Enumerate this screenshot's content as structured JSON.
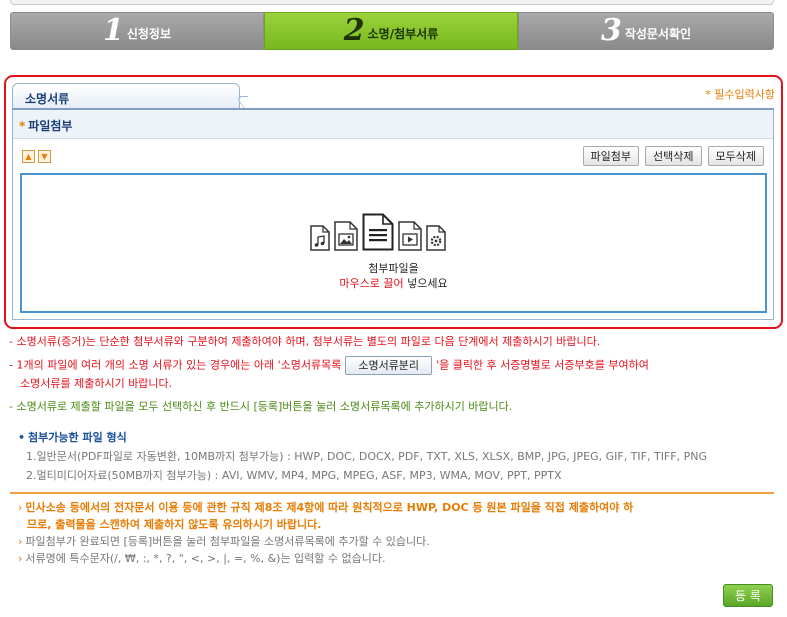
{
  "steps": [
    {
      "num": "1",
      "label": "신청정보"
    },
    {
      "num": "2",
      "label": "소명/첨부서류"
    },
    {
      "num": "3",
      "label": "작성문서확인"
    }
  ],
  "section": {
    "tab_title": "소명서류",
    "required_note": "* 필수입력사항",
    "panel_title": "파일첨부"
  },
  "toolbar": {
    "up_icon": "▲",
    "down_icon": "▼",
    "attach_label": "파일첨부",
    "delete_selected_label": "선택삭제",
    "delete_all_label": "모두삭제"
  },
  "dropzone": {
    "text_line1": "첨부파일을",
    "text_red": "마우스로 끌어",
    "text_rest": " 넣으세요"
  },
  "notes": {
    "line1": "- 소명서류(증거)는 단순한 첨부서류와 구분하여 제출하여야 하며, 첨부서류는 별도의 파일로 다음 단계에서 제출하시기 바랍니다.",
    "line2_a": "- 1개의 파일에 여러 개의 소명 서류가 있는 경우에는 아래 '소명서류목록",
    "line2_button": "소명서류분리",
    "line2_b": "'을 클릭한 후 서증명별로 서증부호를 부여하여",
    "line2_c": "소명서류를 제출하시기 바랍니다.",
    "line3": "- 소명서류로 제출할 파일을 모두 선택하신 후 반드시 [등록]버튼을 눌러 소명서류목록에 추가하시기 바랍니다."
  },
  "formats": {
    "title": "첨부가능한 파일 형식",
    "line1": "1.일반문서(PDF파일로 자동변환, 10MB까지 첨부가능) : HWP, DOC, DOCX, PDF, TXT, XLS, XLSX, BMP, JPG, JPEG, GIF, TIF, TIFF, PNG",
    "line2": "2.멀티미디어자료(50MB까지 첨부가능) : AVI, WMV, MP4, MPG, MPEG, ASF, MP3, WMA, MOV, PPT, PPTX"
  },
  "warnings": {
    "line1": "민사소송 등에서의 전자문서 이용 등에 관한 규칙 제8조 제4항에 따라 원칙적으로 HWP, DOC 등 원본 파일을 직접 제출하여야 하",
    "line1b": "므로, 출력물을 스캔하여 제출하지 않도록 유의하시기 바랍니다.",
    "line2": "파일첨부가 완료되면 [등록]버튼을 눌러 첨부파일을 소명서류목록에 추가할 수 있습니다.",
    "line3": "서류명에 특수문자(/, ₩, :, *, ?, \", <, >, |, =, %, &)는 입력할 수 없습니다."
  },
  "register_label": "등 록",
  "colors": {
    "active_step": "#8cc63f",
    "inactive_step": "#999999",
    "accent_blue": "#4a93d1",
    "warning_red": "#e5101b",
    "note_green": "#4c8a16",
    "orange": "#e87d05"
  },
  "icons": {
    "file_types": [
      "music-file-icon",
      "image-file-icon",
      "document-file-icon",
      "video-file-icon",
      "settings-file-icon"
    ]
  }
}
